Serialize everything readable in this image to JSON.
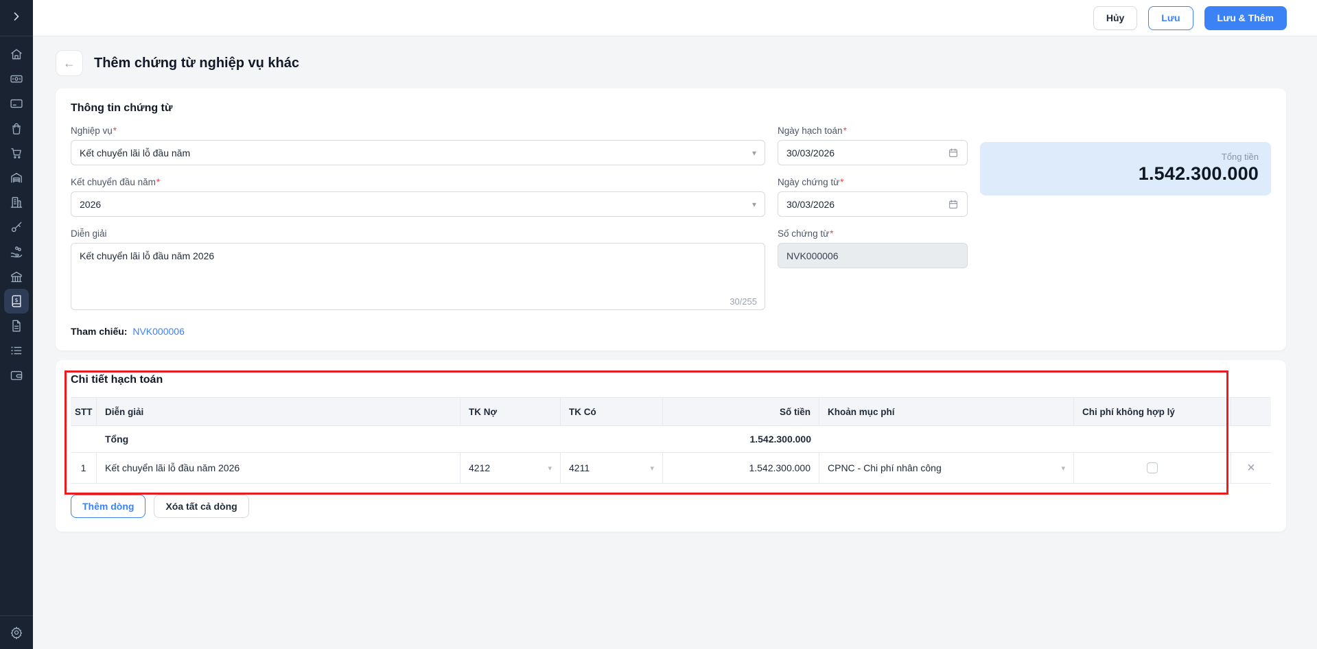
{
  "colors": {
    "accent_blue": "#3b82f6",
    "annotation_red": "#ec1b21",
    "sidebar_bg": "#1a2332",
    "total_box_bg": "#ddebfb"
  },
  "icons": {
    "back": "←",
    "delete_row": "×",
    "caret": "▾",
    "gear": "⚙",
    "sidebar_items": [
      "chevron-right-icon",
      "home-icon",
      "banknote-icon",
      "credit-card-icon",
      "shopping-bag-icon",
      "shopping-cart-icon",
      "warehouse-icon",
      "office-building-icon",
      "key-tools-icon",
      "hand-coins-icon",
      "bank-icon",
      "ledger-book-icon",
      "document-icon",
      "list-icon",
      "wallet-icon",
      "gear-icon"
    ]
  },
  "topbar": {
    "cancel_label": "Hủy",
    "save_label": "Lưu",
    "save_add_label": "Lưu & Thêm"
  },
  "page": {
    "title": "Thêm chứng từ nghiệp vụ khác"
  },
  "misc": {
    "required_mark": "*"
  },
  "doc_info": {
    "section_title": "Thông tin chứng từ",
    "fields": {
      "nghiep_vu": {
        "label": "Nghiệp vụ",
        "value": "Kết chuyển lãi lỗ đầu năm"
      },
      "ket_chuyen_dau_nam": {
        "label": "Kết chuyển đầu năm",
        "value": "2026"
      },
      "dien_giai": {
        "label": "Diễn giải",
        "value": "Kết chuyển lãi lỗ đầu năm 2026",
        "counter": "30/255"
      },
      "ngay_hach_toan": {
        "label": "Ngày hạch toán",
        "value": "30/03/2026"
      },
      "ngay_chung_tu": {
        "label": "Ngày chứng từ",
        "value": "30/03/2026"
      },
      "so_chung_tu": {
        "label": "Số chứng từ",
        "value": "NVK000006"
      }
    },
    "total_box": {
      "label": "Tổng tiền",
      "value": "1.542.300.000"
    },
    "reference": {
      "label": "Tham chiếu:",
      "value": "NVK000006"
    }
  },
  "detail": {
    "section_title": "Chi tiết hạch toán",
    "columns": [
      "STT",
      "Diễn giải",
      "TK Nợ",
      "TK Có",
      "Số tiền",
      "Khoản mục phí",
      "Chi phí không hợp lý"
    ],
    "total_row": {
      "label": "Tổng",
      "amount": "1.542.300.000"
    },
    "rows": [
      {
        "stt": "1",
        "description": "Kết chuyển lãi lỗ đầu năm 2026",
        "tk_no": "4212",
        "tk_co": "4211",
        "amount": "1.542.300.000",
        "expense_item": "CPNC - Chi phí nhân công",
        "invalid_expense_checked": false
      }
    ],
    "add_row_label": "Thêm dòng",
    "delete_all_label": "Xóa tất cả dòng"
  }
}
